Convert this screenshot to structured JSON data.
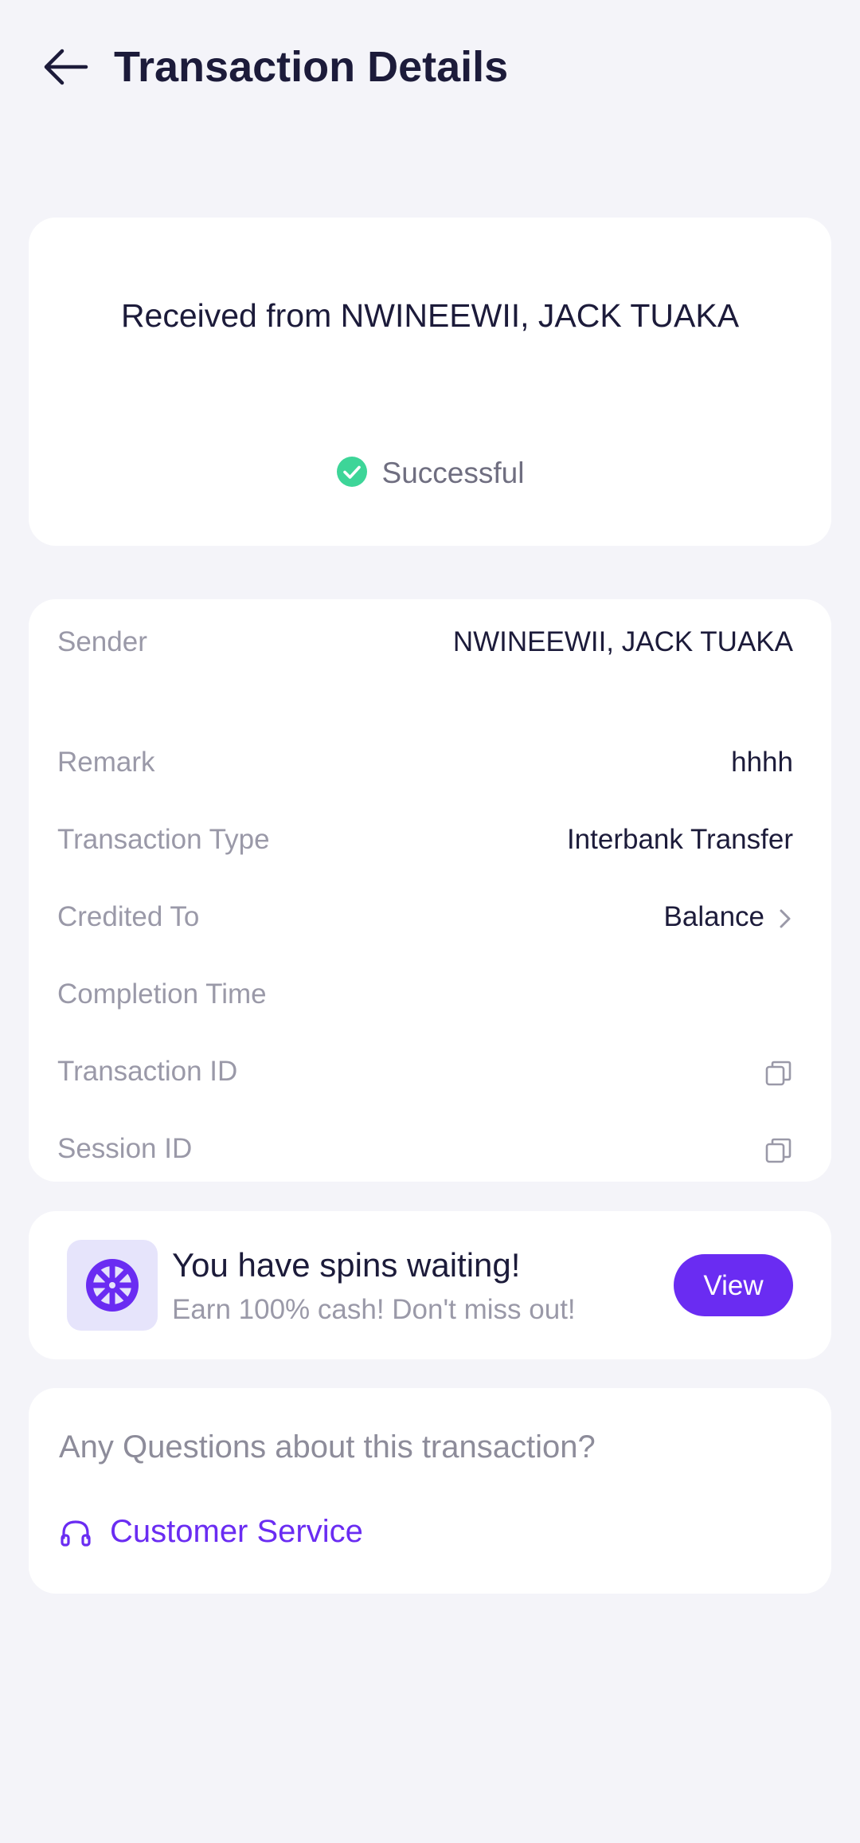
{
  "header": {
    "title": "Transaction Details",
    "back_icon": "arrow-left-icon"
  },
  "summary": {
    "received_text": "Received from NWINEEWII, JACK TUAKA",
    "status": "Successful",
    "status_icon": "check-circle-icon",
    "status_color": "#3dd598"
  },
  "details": {
    "rows": [
      {
        "label": "Sender",
        "value": "NWINEEWII, JACK TUAKA"
      },
      {
        "label": "Remark",
        "value": "hhhh"
      },
      {
        "label": "Transaction Type",
        "value": "Interbank Transfer"
      },
      {
        "label": "Credited To",
        "value": "Balance"
      },
      {
        "label": "Completion Time",
        "value": ""
      },
      {
        "label": "Transaction ID",
        "value": ""
      },
      {
        "label": "Session ID",
        "value": ""
      }
    ]
  },
  "promo": {
    "title": "You have spins waiting!",
    "subtitle": "Earn 100% cash! Don't miss out!",
    "button_label": "View",
    "icon": "spin-wheel-icon"
  },
  "help": {
    "question": "Any Questions about this transaction?",
    "link_label": "Customer Service",
    "link_icon": "headset-icon"
  },
  "colors": {
    "accent": "#6a2cf2",
    "background": "#f4f4f9",
    "success": "#3dd598"
  }
}
